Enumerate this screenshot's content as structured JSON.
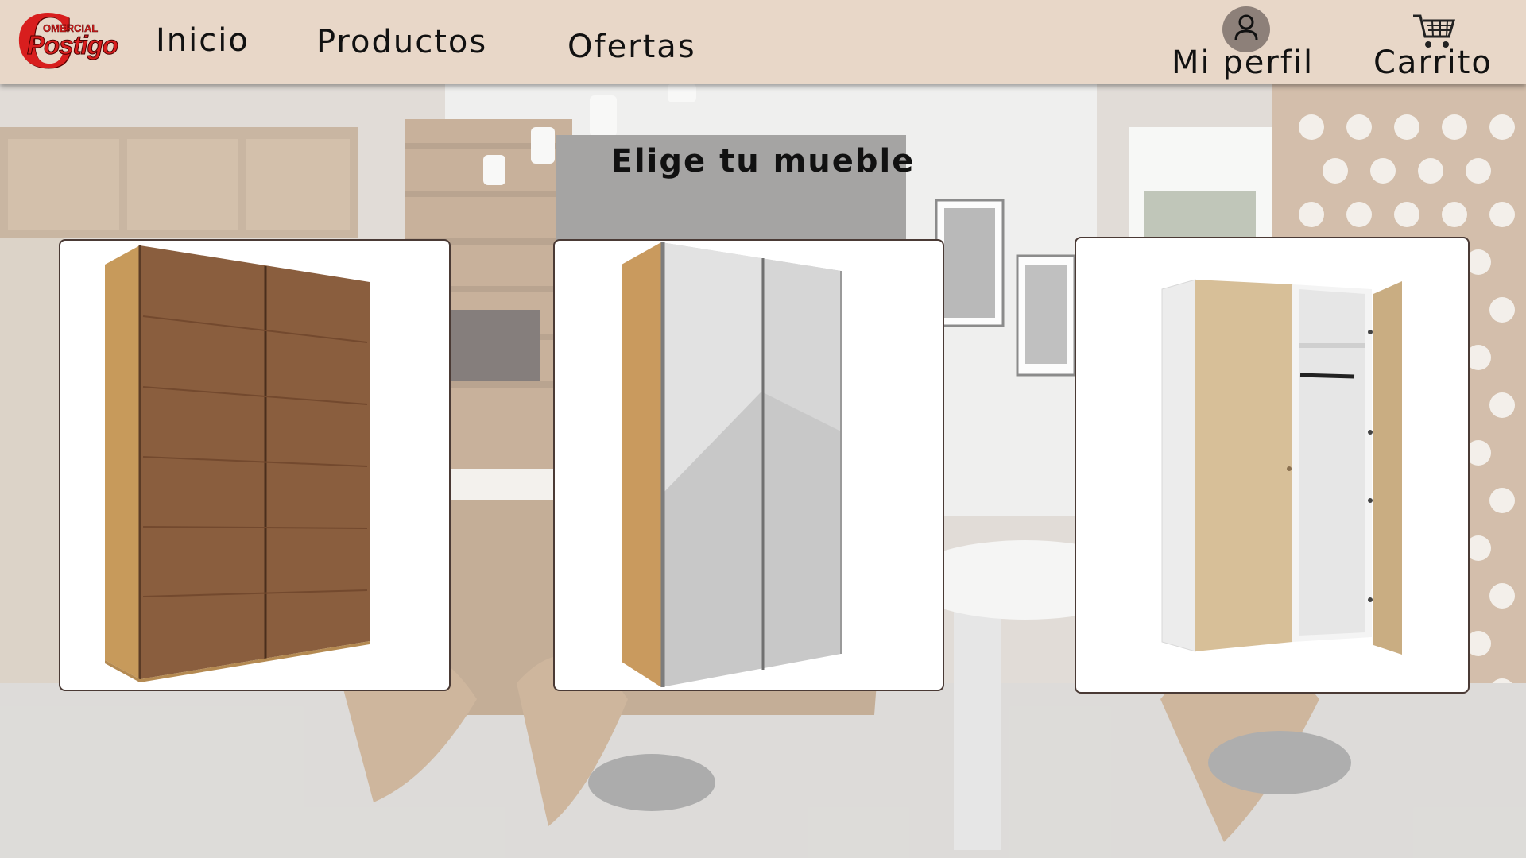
{
  "brand": {
    "logo_letter": "C",
    "logo_top": "OMERCIAL",
    "logo_main": "Postigo",
    "logo_color": "#d81e1e"
  },
  "nav": {
    "links": [
      "Inicio",
      "Productos",
      "Ofertas"
    ],
    "profile_label": "Mi perfil",
    "profile_icon": "user-avatar-icon",
    "cart_label": "Carrito",
    "cart_icon": "shopping-cart-icon",
    "bar_color": "#e8d7c8"
  },
  "main": {
    "heading": "Elige tu mueble",
    "products": [
      {
        "name": "wardrobe-walnut-sliding-doors",
        "image": "wardrobe-wood-panels"
      },
      {
        "name": "wardrobe-grey-gloss-sliding-doors",
        "image": "wardrobe-grey-gloss"
      },
      {
        "name": "wardrobe-oak-open-door",
        "image": "wardrobe-open-interior"
      }
    ]
  }
}
